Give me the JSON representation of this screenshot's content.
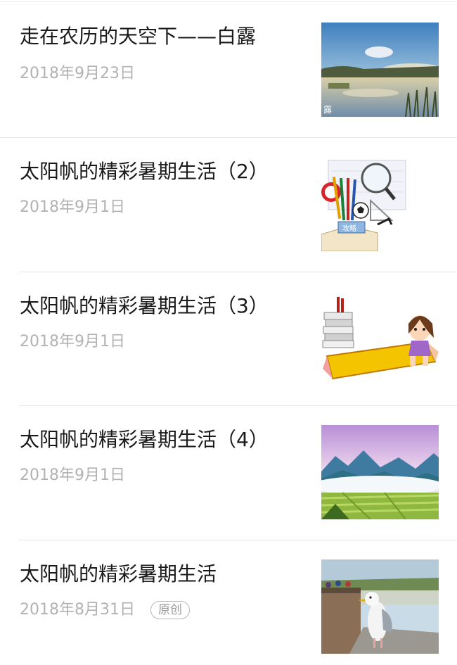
{
  "articles": [
    {
      "title": "走在农历的天空下——白露",
      "date": "2018年9月23日",
      "thumb_icon": "misty-lake-photo",
      "thumb_caption": "露"
    },
    {
      "title": "太阳帆的精彩暑期生活（2）",
      "date": "2018年9月1日",
      "thumb_icon": "school-supplies-illustration",
      "thumb_caption": "攻略"
    },
    {
      "title": "太阳帆的精彩暑期生活（3）",
      "date": "2018年9月1日",
      "thumb_icon": "girl-on-pencil-illustration"
    },
    {
      "title": "太阳帆的精彩暑期生活（4）",
      "date": "2018年9月1日",
      "thumb_icon": "mountain-fields-photo"
    },
    {
      "title": "太阳帆的精彩暑期生活",
      "date": "2018年8月31日",
      "badge": "原创",
      "thumb_icon": "seagull-photo"
    }
  ],
  "colors": {
    "title": "#1a1a1a",
    "date": "#b2b2b2",
    "divider": "#e6e6e6"
  }
}
